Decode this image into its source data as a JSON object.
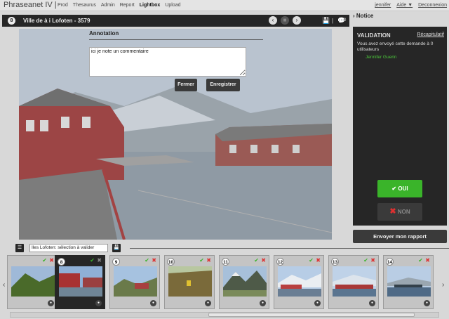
{
  "app": {
    "brand": "Phraseanet IV |"
  },
  "nav": [
    "Prod",
    "Thesaurus",
    "Admin",
    "Report",
    "Lightbox",
    "Upload"
  ],
  "user_links": {
    "user": "jennifer",
    "help": "Aide ▼",
    "logout": "Deconnexion"
  },
  "viewer": {
    "number": "8",
    "title": "Ville de à i Lofoten - 3579",
    "count": "0"
  },
  "annotation": {
    "title": "Annotation",
    "text": "ici je note un commentaire",
    "close_label": "Fermer",
    "save_label": "Enregistrer"
  },
  "notice": {
    "header": "Notice",
    "validation_title": "VALIDATION",
    "summary_link": "Récapitulatif",
    "message": "Vous avez envoyé cette demande à 0 utilisateurs",
    "user": "Jennifer Guerin",
    "ok_label": "OUI",
    "no_label": "NON"
  },
  "send_report": "Envoyer mon rapport",
  "basket": {
    "selection": "Iles Lofoten: sélection à valider"
  },
  "thumbnails": [
    {
      "num": "",
      "current": false,
      "sky": "#9fb9d8",
      "ground": "#4a6a2a"
    },
    {
      "num": "8",
      "current": true,
      "sky": "#8fb0d6",
      "ground": "#7a2a2a"
    },
    {
      "num": "9",
      "current": false,
      "sky": "#a6c2e0",
      "ground": "#6a7a4a"
    },
    {
      "num": "10",
      "current": false,
      "sky": "#b8c7a0",
      "ground": "#7a6a3a"
    },
    {
      "num": "11",
      "current": false,
      "sky": "#a7c0da",
      "ground": "#4e5a48"
    },
    {
      "num": "12",
      "current": false,
      "sky": "#b7cde6",
      "ground": "#6a4a3a"
    },
    {
      "num": "13",
      "current": false,
      "sky": "#bfd2e8",
      "ground": "#8a3a30"
    },
    {
      "num": "14",
      "current": false,
      "sky": "#b9cde4",
      "ground": "#33404a"
    }
  ],
  "colors": {
    "accent_green": "#3ab42a",
    "dark_panel": "#262626"
  }
}
